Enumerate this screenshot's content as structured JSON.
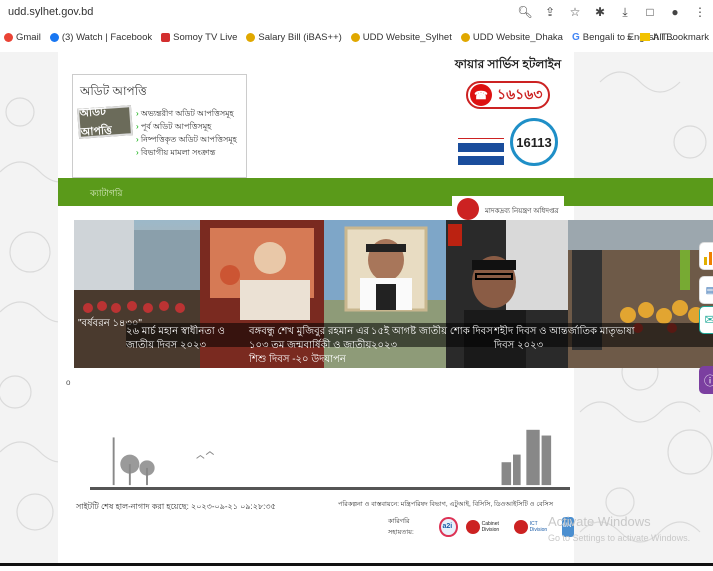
{
  "browser": {
    "url": "udd.sylhet.gov.bd",
    "bookmarks": [
      {
        "label": "Gmail",
        "color": "#ea4335"
      },
      {
        "label": "(3) Watch | Facebook",
        "color": "#1877f2"
      },
      {
        "label": "Somoy TV Live",
        "color": "#d32f2f"
      },
      {
        "label": "Salary Bill (iBAS++)",
        "color": "#e0a800"
      },
      {
        "label": "UDD Website_Sylhet",
        "color": "#e0a800"
      },
      {
        "label": "UDD Website_Dhaka",
        "color": "#e0a800"
      },
      {
        "label": "Bengali to English T...",
        "color": "#4285f4"
      }
    ],
    "more_label": "»",
    "all_bookmarks_label": "All Bookmark"
  },
  "audit": {
    "title": "অডিট আপত্তি",
    "stamp_text": "অডিট আপত্তি",
    "links": [
      "অভ্যন্তরীণ অডিট আপত্তিসমূহ",
      "পূর্ব অডিট আপত্তিসমূহ",
      "নিষ্পত্তিকৃত অডিট আপত্তিসমূহ",
      "বিভাগীয় মামলা সংক্রান্ত"
    ]
  },
  "hotline": {
    "title": "ফায়ার সার্ভিস হটলাইন",
    "number": "১৬১৬৩",
    "women_number": "16113"
  },
  "green_bar": {
    "label": "ক্যাটাগরি"
  },
  "emblem": {
    "text": "মাদকদ্রব্য নিয়ন্ত্রণ অধিদপ্তর"
  },
  "carousel": {
    "slides": [
      {
        "caption": "\"বর্ষবরন ১৪৩০\""
      },
      {
        "caption": "২৬ মার্চ মহান স্বাধীনতা ও জাতীয় দিবস ২০২৩"
      },
      {
        "caption": "বঙ্গবন্ধু শেখ মুজিবুর রহমান এর ১০৩ তম জন্মবার্ষিকী ও জাতীয় শিশু দিবস -২০ উদযাপন"
      },
      {
        "caption": "১৫ই আগষ্ট জাতীয় শোক দিবস ২০২৩"
      },
      {
        "caption": "শহীদ দিবস ও আন্তর্জাতিক মাতৃভাষা দিবস ২০২৩"
      }
    ]
  },
  "below_marker": "o",
  "footer": {
    "last_updated": "সাইটটি শেষ হাল-নাগাদ করা হয়েছে: ২০২৩-০৯-২১ ০৯:২৮:৩৫",
    "credits": "পরিকল্পনা ও বাস্তবায়নে: মন্ত্রিপরিষদ বিভাগ, এটুআই, বিসিসি, ডিওআইসিটি ও বেসিস",
    "tech_partners_label": "কারিগরি সহায়তায়:",
    "partners": [
      "a2i",
      "Cabinet Division",
      "ICT Division",
      "UN"
    ]
  },
  "watermark": {
    "line1": "Activate Windows",
    "line2": "Go to Settings to activate Windows."
  }
}
